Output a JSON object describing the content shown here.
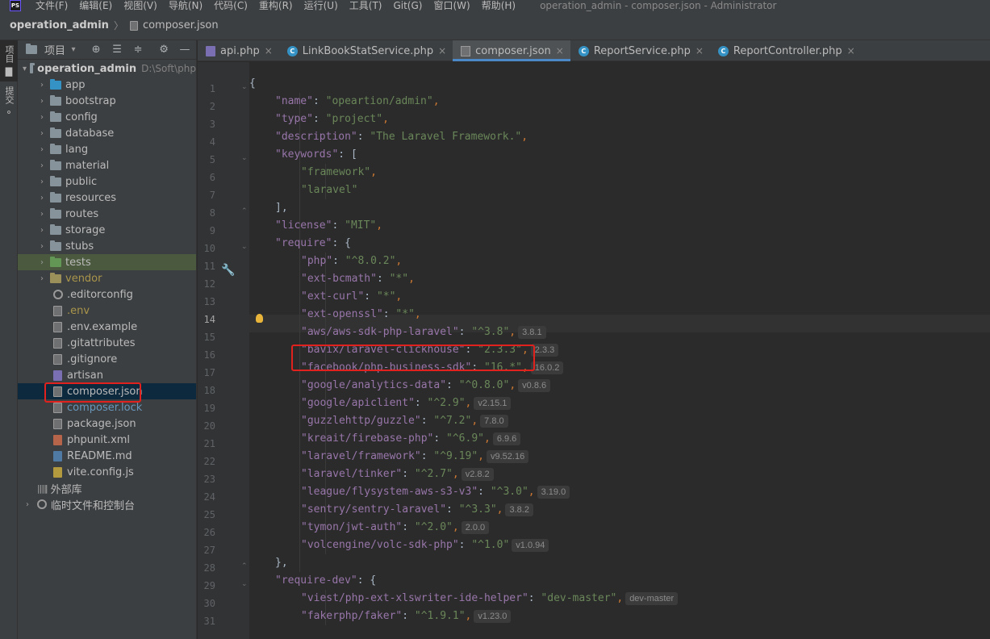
{
  "app": {
    "logo": "PS",
    "window_title": "operation_admin - composer.json - Administrator",
    "menu": [
      "文件(F)",
      "编辑(E)",
      "视图(V)",
      "导航(N)",
      "代码(C)",
      "重构(R)",
      "运行(U)",
      "工具(T)",
      "Git(G)",
      "窗口(W)",
      "帮助(H)"
    ]
  },
  "navbar": {
    "project": "operation_admin",
    "file": "composer.json"
  },
  "toolstrip": {
    "project_label": "项目",
    "commit_label": "提交"
  },
  "project_panel": {
    "title": "项目",
    "root": {
      "name": "operation_admin",
      "path": "D:\\Soft\\php"
    },
    "folders": [
      "app",
      "bootstrap",
      "config",
      "database",
      "lang",
      "material",
      "public",
      "resources",
      "routes",
      "storage",
      "stubs",
      "tests",
      "vendor"
    ],
    "files": [
      ".editorconfig",
      ".env",
      ".env.example",
      ".gitattributes",
      ".gitignore",
      "artisan",
      "composer.json",
      "composer.lock",
      "package.json",
      "phpunit.xml",
      "README.md",
      "vite.config.js"
    ],
    "external_libs": "外部库",
    "scratches": "临时文件和控制台"
  },
  "tabs": [
    {
      "label": "api.php",
      "icon": "php-file-icon"
    },
    {
      "label": "LinkBookStatService.php",
      "icon": "class-icon"
    },
    {
      "label": "composer.json",
      "icon": "json-file-icon",
      "active": true
    },
    {
      "label": "ReportService.php",
      "icon": "class-icon"
    },
    {
      "label": "ReportController.php",
      "icon": "class-icon"
    }
  ],
  "editor": {
    "line_numbers": [
      "1",
      "2",
      "3",
      "4",
      "5",
      "6",
      "7",
      "8",
      "9",
      "10",
      "11",
      "12",
      "13",
      "14",
      "15",
      "16",
      "17",
      "18",
      "19",
      "20",
      "21",
      "22",
      "23",
      "24",
      "25",
      "26",
      "27",
      "28",
      "29",
      "30",
      "31"
    ],
    "current_line": 14,
    "lines": [
      {
        "indent": 0,
        "punct": "{"
      },
      {
        "indent": 1,
        "key": "name",
        "value": "opeartion/admin",
        "comma": true
      },
      {
        "indent": 1,
        "key": "type",
        "value": "project",
        "comma": true
      },
      {
        "indent": 1,
        "key": "description",
        "value": "The Laravel Framework.",
        "comma": true
      },
      {
        "indent": 1,
        "key": "keywords",
        "open": "["
      },
      {
        "indent": 2,
        "value": "framework",
        "comma": true
      },
      {
        "indent": 2,
        "value": "laravel"
      },
      {
        "indent": 1,
        "punct": "],"
      },
      {
        "indent": 1,
        "key": "license",
        "value": "MIT",
        "comma": true
      },
      {
        "indent": 1,
        "key": "require",
        "open": "{"
      },
      {
        "indent": 2,
        "key": "php",
        "value": "^8.0.2",
        "comma": true
      },
      {
        "indent": 2,
        "key": "ext-bcmath",
        "value": "*",
        "comma": true
      },
      {
        "indent": 2,
        "key": "ext-curl",
        "value": "*",
        "comma": true
      },
      {
        "indent": 2,
        "key": "ext-openssl",
        "value": "*",
        "comma": true
      },
      {
        "indent": 2,
        "key": "aws/aws-sdk-php-laravel",
        "value": "^3.8",
        "comma": true,
        "hint": "3.8.1"
      },
      {
        "indent": 2,
        "key": "bavix/laravel-clickhouse",
        "value": "2.3.3",
        "comma": true,
        "hint": "2.3.3"
      },
      {
        "indent": 2,
        "key": "facebook/php-business-sdk",
        "value": "16.*",
        "comma": true,
        "hint": "16.0.2"
      },
      {
        "indent": 2,
        "key": "google/analytics-data",
        "value": "^0.8.0",
        "comma": true,
        "hint": "v0.8.6"
      },
      {
        "indent": 2,
        "key": "google/apiclient",
        "value": "^2.9",
        "comma": true,
        "hint": "v2.15.1"
      },
      {
        "indent": 2,
        "key": "guzzlehttp/guzzle",
        "value": "^7.2",
        "comma": true,
        "hint": "7.8.0"
      },
      {
        "indent": 2,
        "key": "kreait/firebase-php",
        "value": "^6.9",
        "comma": true,
        "hint": "6.9.6"
      },
      {
        "indent": 2,
        "key": "laravel/framework",
        "value": "^9.19",
        "comma": true,
        "hint": "v9.52.16"
      },
      {
        "indent": 2,
        "key": "laravel/tinker",
        "value": "^2.7",
        "comma": true,
        "hint": "v2.8.2"
      },
      {
        "indent": 2,
        "key": "league/flysystem-aws-s3-v3",
        "value": "^3.0",
        "comma": true,
        "hint": "3.19.0"
      },
      {
        "indent": 2,
        "key": "sentry/sentry-laravel",
        "value": "^3.3",
        "comma": true,
        "hint": "3.8.2"
      },
      {
        "indent": 2,
        "key": "tymon/jwt-auth",
        "value": "^2.0",
        "comma": true,
        "hint": "2.0.0"
      },
      {
        "indent": 2,
        "key": "volcengine/volc-sdk-php",
        "value": "^1.0",
        "hint": "v1.0.94"
      },
      {
        "indent": 1,
        "punct": "},"
      },
      {
        "indent": 1,
        "key": "require-dev",
        "open": "{"
      },
      {
        "indent": 2,
        "key": "viest/php-ext-xlswriter-ide-helper",
        "value": "dev-master",
        "comma": true,
        "hint": "dev-master"
      },
      {
        "indent": 2,
        "key": "fakerphp/faker",
        "value": "^1.9.1",
        "comma": true,
        "hint": "v1.23.0"
      }
    ]
  },
  "colors": {
    "highlight_box": "#e0211d",
    "selection": "#0d293e",
    "tab_accent": "#4a88c7"
  }
}
